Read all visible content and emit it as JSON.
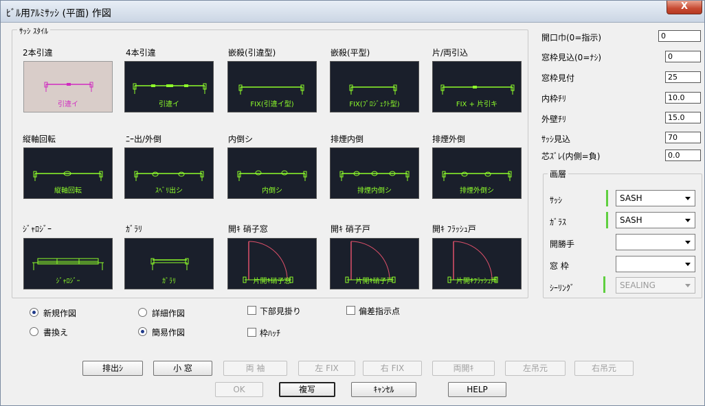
{
  "window": {
    "title": "ﾋﾞﾙ用ｱﾙﾐｻｯｼ (平面) 作図",
    "close_glyph": "X"
  },
  "sash_style": {
    "legend": "ｻｯｼ ｽﾀｲﾙ",
    "tiles": [
      {
        "label": "2本引違",
        "caption": "引違イ",
        "selected": true
      },
      {
        "label": "4本引違",
        "caption": "引違イ",
        "selected": false
      },
      {
        "label": "嵌殺(引違型)",
        "caption": "FIX(引違イ型)",
        "selected": false
      },
      {
        "label": "嵌殺(平型)",
        "caption": "FIX(ﾌﾟﾛｼﾞｪｸﾄ型)",
        "selected": false
      },
      {
        "label": "片/両引込",
        "caption": "FIX + 片引キ",
        "selected": false
      },
      {
        "label": "縦軸回転",
        "caption": "縦軸回転",
        "selected": false
      },
      {
        "label": "ﾆｰ出/外倒",
        "caption": "ｽﾍﾞﾘ出シ",
        "selected": false
      },
      {
        "label": "内倒シ",
        "caption": "内倒シ",
        "selected": false
      },
      {
        "label": "排煙内倒",
        "caption": "排煙内倒シ",
        "selected": false
      },
      {
        "label": "排煙外倒",
        "caption": "排煙外倒シ",
        "selected": false
      },
      {
        "label": "ｼﾞｬﾛｼﾞｰ",
        "caption": "ｼﾞｬﾛｼﾞｰ",
        "selected": false
      },
      {
        "label": "ｶﾞﾗﾘ",
        "caption": "ｶﾞﾗﾘ",
        "selected": false
      },
      {
        "label": "開ｷ 硝子窓",
        "caption": "片開ｷ硝子窓",
        "selected": false
      },
      {
        "label": "開ｷ 硝子戸",
        "caption": "片開ｷ硝子戸",
        "selected": false
      },
      {
        "label": "開ｷ ﾌﾗｯｼｭ戸",
        "caption": "片開ｷﾌﾗｯｼｭ戸",
        "selected": false
      }
    ]
  },
  "params": [
    {
      "label": "開口巾(0=指示)",
      "value": "0"
    },
    {
      "label": "窓枠見込(0=ﾅｼ)",
      "value": "0"
    },
    {
      "label": "窓枠見付",
      "value": "25"
    },
    {
      "label": "内枠ﾁﾘ",
      "value": "10.0"
    },
    {
      "label": "外壁ﾁﾘ",
      "value": "15.0"
    },
    {
      "label": "ｻｯｼ見込",
      "value": "70"
    },
    {
      "label": "芯ｽﾞﾚ(内側=負)",
      "value": "0.0"
    }
  ],
  "layers": {
    "legend": "画層",
    "rows": [
      {
        "label": "ｻｯｼ",
        "value": "SASH",
        "bar": true,
        "disabled": false
      },
      {
        "label": "ｶﾞﾗｽ",
        "value": "SASH",
        "bar": true,
        "disabled": false
      },
      {
        "label": "開勝手",
        "value": "",
        "bar": false,
        "disabled": false
      },
      {
        "label": "窓 枠",
        "value": "",
        "bar": false,
        "disabled": false
      },
      {
        "label": "ｼｰﾘﾝｸﾞ",
        "value": "SEALING",
        "bar": true,
        "disabled": true
      }
    ]
  },
  "options": {
    "new_draw": "新規作図",
    "rewrite": "書換え",
    "detail_draw": "詳細作図",
    "simple_draw": "簡易作図",
    "lower_view": "下部見掛り",
    "frame_hatch": "枠ﾊｯﾁ",
    "offset_point": "偏差指示点"
  },
  "buttons_row1": [
    {
      "label": "排出ｼ",
      "enabled": true
    },
    {
      "label": "小 窓",
      "enabled": true
    },
    {
      "label": "両 袖",
      "enabled": false
    },
    {
      "label": "左 FIX",
      "enabled": false
    },
    {
      "label": "右 FIX",
      "enabled": false
    },
    {
      "label": "両開ｷ",
      "enabled": false
    },
    {
      "label": "左吊元",
      "enabled": false
    },
    {
      "label": "右吊元",
      "enabled": false
    }
  ],
  "buttons_row2": [
    {
      "label": "OK",
      "enabled": false
    },
    {
      "label": "複写",
      "enabled": true
    },
    {
      "label": "ｷｬﾝｾﾙ",
      "enabled": true
    },
    {
      "label": "HELP",
      "enabled": true
    }
  ],
  "colors": {
    "tile_bg": "#1a1f2b",
    "line_green": "#8fff2a",
    "line_magenta": "#d02bc0",
    "door_red": "#e0506a"
  }
}
